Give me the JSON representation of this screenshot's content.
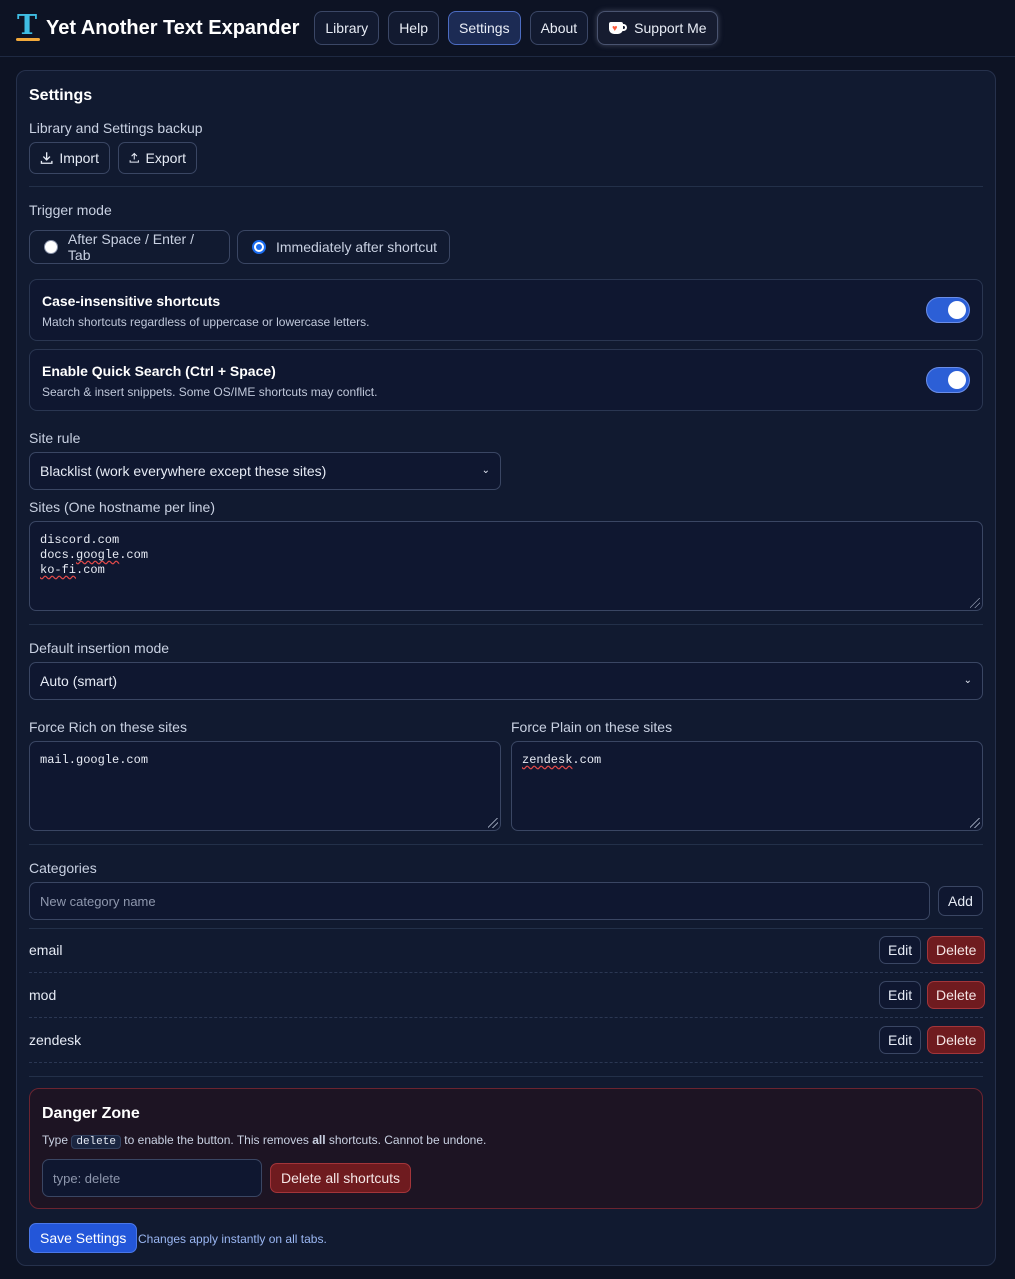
{
  "app": {
    "title": "Yet Another Text Expander"
  },
  "nav": {
    "library": "Library",
    "help": "Help",
    "settings": "Settings",
    "about": "About",
    "support": "Support Me"
  },
  "settings": {
    "heading": "Settings",
    "backup_label": "Library and Settings backup",
    "import_label": "Import",
    "export_label": "Export",
    "trigger_label": "Trigger mode",
    "trigger_options": [
      "After Space / Enter / Tab",
      "Immediately after shortcut"
    ],
    "trigger_selected": "Immediately after shortcut",
    "case_title": "Case-insensitive shortcuts",
    "case_desc": "Match shortcuts regardless of uppercase or lowercase letters.",
    "case_enabled": true,
    "quick_title": "Enable Quick Search (Ctrl + Space)",
    "quick_desc": "Search & insert snippets. Some OS/IME shortcuts may conflict.",
    "quick_enabled": true,
    "site_rule_label": "Site rule",
    "site_rule_value": "Blacklist (work everywhere except these sites)",
    "sites_label": "Sites (One hostname per line)",
    "sites": [
      "discord.com",
      "docs.google.com",
      "ko-fi.com"
    ],
    "insertion_label": "Default insertion mode",
    "insertion_value": "Auto (smart)",
    "force_rich_label": "Force Rich on these sites",
    "force_rich_sites": [
      "mail.google.com"
    ],
    "force_plain_label": "Force Plain on these sites",
    "force_plain_sites": [
      "zendesk.com"
    ],
    "categories_label": "Categories",
    "category_placeholder": "New category name",
    "add_label": "Add",
    "categories": [
      {
        "name": "email",
        "edit": "Edit",
        "delete": "Delete"
      },
      {
        "name": "mod",
        "edit": "Edit",
        "delete": "Delete"
      },
      {
        "name": "zendesk",
        "edit": "Edit",
        "delete": "Delete"
      }
    ],
    "danger": {
      "title": "Danger Zone",
      "desc_pre": "Type ",
      "desc_kbd": "delete",
      "desc_mid": " to enable the button. This removes ",
      "desc_bold": "all",
      "desc_post": " shortcuts. Cannot be undone.",
      "placeholder": "type: delete",
      "button": "Delete all shortcuts"
    },
    "save_label": "Save Settings",
    "save_hint": "Changes apply instantly on all tabs."
  },
  "colors": {
    "background": "#0d1324",
    "accent": "#2356d9",
    "danger": "#6f1b1f",
    "logo_t": "#3fbde3",
    "logo_bar": "#f2a93b"
  }
}
